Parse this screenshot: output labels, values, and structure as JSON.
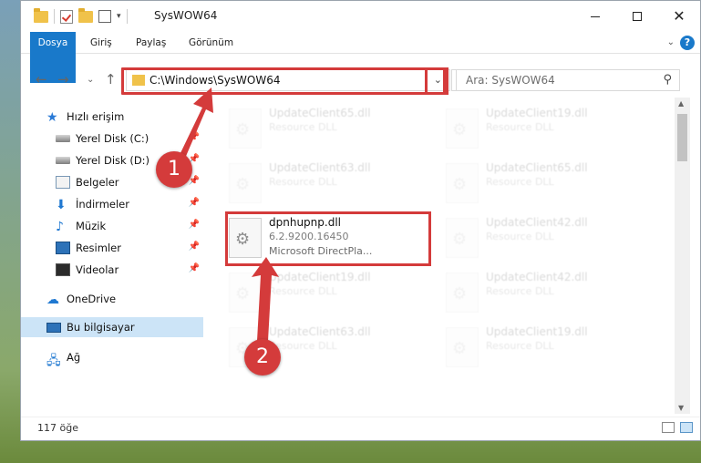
{
  "window": {
    "title": "SysWOW64"
  },
  "ribbon": {
    "tabs": [
      "Dosya",
      "Giriş",
      "Paylaş",
      "Görünüm"
    ]
  },
  "address": {
    "path": "C:\\Windows\\SysWOW64"
  },
  "search": {
    "placeholder": "Ara: SysWOW64"
  },
  "sidebar": {
    "items": [
      {
        "label": "Hızlı erişim",
        "icon": "star-icon"
      },
      {
        "label": "Yerel Disk (C:)",
        "icon": "disk-icon",
        "pinned": true
      },
      {
        "label": "Yerel Disk (D:)",
        "icon": "disk-icon",
        "pinned": true
      },
      {
        "label": "Belgeler",
        "icon": "documents-icon",
        "pinned": true
      },
      {
        "label": "İndirmeler",
        "icon": "download-icon",
        "pinned": true
      },
      {
        "label": "Müzik",
        "icon": "music-icon",
        "pinned": true
      },
      {
        "label": "Resimler",
        "icon": "pictures-icon",
        "pinned": true
      },
      {
        "label": "Videolar",
        "icon": "videos-icon",
        "pinned": true
      },
      {
        "label": "OneDrive",
        "icon": "cloud-icon"
      },
      {
        "label": "Bu bilgisayar",
        "icon": "computer-icon",
        "selected": true
      },
      {
        "label": "Ağ",
        "icon": "network-icon"
      }
    ]
  },
  "files": [
    {
      "name": "UpdateClient65.dll",
      "desc": "Resource DLL",
      "faded": true
    },
    {
      "name": "UpdateClient19.dll",
      "desc": "Resource DLL",
      "faded": true
    },
    {
      "name": "UpdateClient63.dll",
      "desc": "Resource DLL",
      "faded": true
    },
    {
      "name": "UpdateClient65.dll",
      "desc": "Resource DLL",
      "faded": true
    },
    {
      "name": "dpnhupnp.dll",
      "desc": "6.2.9200.16450",
      "desc2": "Microsoft DirectPla...",
      "faded": false
    },
    {
      "name": "UpdateClient42.dll",
      "desc": "Resource DLL",
      "faded": true
    },
    {
      "name": "UpdateClient19.dll",
      "desc": "Resource DLL",
      "faded": true
    },
    {
      "name": "UpdateClient42.dll",
      "desc": "Resource DLL",
      "faded": true
    },
    {
      "name": "UpdateClient63.dll",
      "desc": "Resource DLL",
      "faded": true
    },
    {
      "name": "UpdateClient19.dll",
      "desc": "Resource DLL",
      "faded": true
    }
  ],
  "status": {
    "count": "117 öğe"
  },
  "annotations": {
    "step1": "1",
    "step2": "2"
  },
  "colors": {
    "accent": "#1979ca",
    "highlight": "#d43b3b",
    "selection": "#cce4f7"
  }
}
